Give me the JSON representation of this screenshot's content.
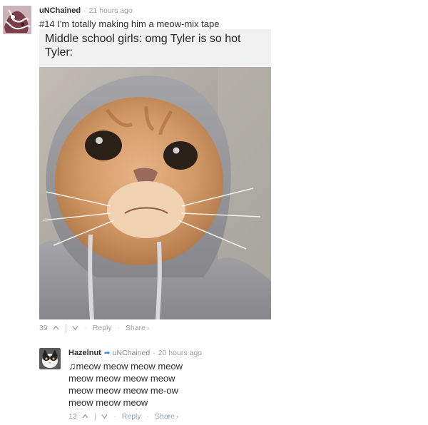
{
  "comment1": {
    "username": "uNChained",
    "timestamp": "21 hours ago",
    "text": "#14 I'm totally making him a meow-mix tape",
    "embedded": {
      "line1": "Middle school girls: omg Tyler is so hot",
      "line2": "Tyler:"
    },
    "votes": "39",
    "upvote_icon": "chevron-up-icon",
    "downvote_icon": "chevron-down-icon",
    "reply_label": "Reply",
    "share_label": "Share",
    "share_icon": "chevron-right-icon"
  },
  "comment2": {
    "username": "Hazelnut",
    "reply_to": "uNChained",
    "timestamp": "20 hours ago",
    "lines": [
      "meow meow meow meow",
      "meow meow meow meow",
      "meow meow meow me-ow",
      "meow meow meow"
    ],
    "music_icon": "music-note-icon",
    "votes": "13",
    "reply_label": "Reply",
    "share_label": "Share"
  },
  "colors": {
    "link_blue": "#4a90d9",
    "meta_gray": "#9aa0a6",
    "embed_bg": "#f1f1f1"
  }
}
